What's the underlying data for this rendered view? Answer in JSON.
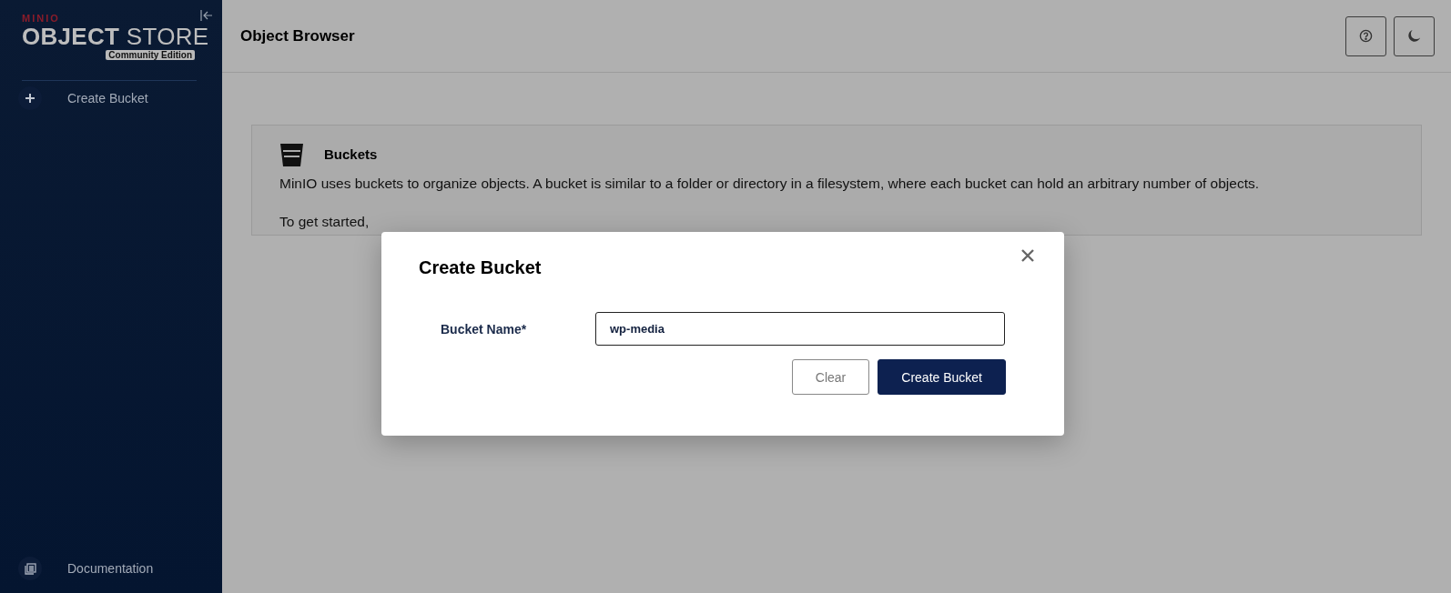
{
  "sidebar": {
    "logo": {
      "brand": "MINIO",
      "product_bold": "OBJECT",
      "product_light": "STORE",
      "edition": "Community Edition"
    },
    "items": [
      {
        "label": "Create Bucket",
        "kind": "plus"
      }
    ],
    "footer_items": [
      {
        "label": "Documentation",
        "kind": "docs"
      }
    ]
  },
  "header": {
    "title": "Object Browser"
  },
  "buckets_card": {
    "title": "Buckets",
    "description": "MinIO uses buckets to organize objects. A bucket is similar to a folder or directory in a filesystem, where each bucket can hold an arbitrary number of objects.",
    "hint": "To get started,"
  },
  "dialog": {
    "title": "Create Bucket",
    "field": {
      "label": "Bucket Name*",
      "value": "wp-media"
    },
    "buttons": [
      {
        "label": "Clear",
        "kind": "secondary"
      },
      {
        "label": "Create Bucket",
        "kind": "primary"
      }
    ]
  }
}
